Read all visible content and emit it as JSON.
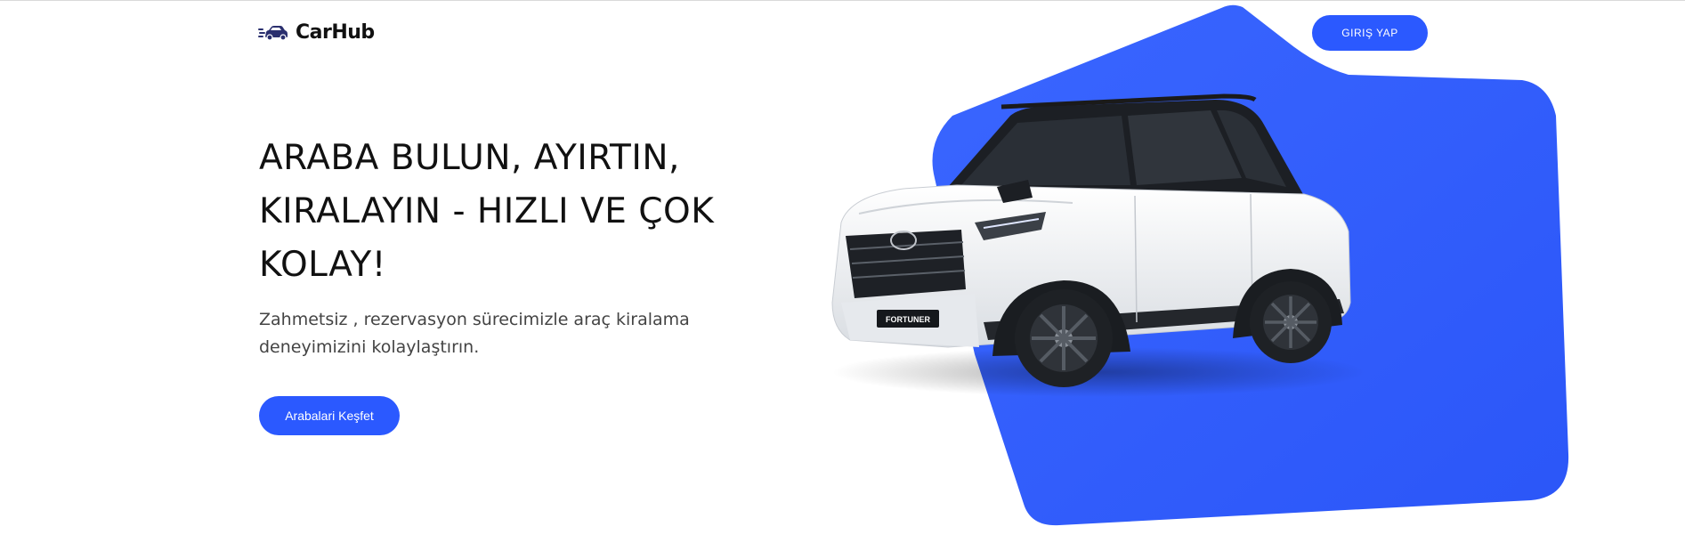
{
  "header": {
    "logo_text": "CarHub",
    "login_label": "GIRIŞ YAP"
  },
  "hero": {
    "title": "ARABA BULUN, AYIRTIN, KIRALAYIN - HIZLI VE ÇOK KOLAY!",
    "subtitle": "Zahmetsiz , rezervasyon sürecimizle araç kiralama deneyimizini kolaylaştırın.",
    "cta_label": "Arabalari Keşfet"
  },
  "car_image": {
    "plate_text": "FORTUNER"
  },
  "colors": {
    "accent": "#2b59ff",
    "blob": "#2f5cfb",
    "text": "#111111",
    "subtitle": "#444444"
  },
  "icons": {
    "logo": "car-icon"
  }
}
